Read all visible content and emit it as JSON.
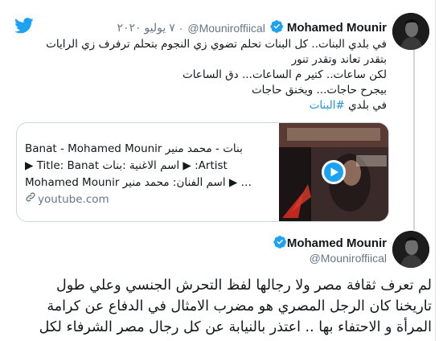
{
  "tweet1": {
    "author_name": "Mohamed Mounir",
    "handle": "@Mouniroffiical",
    "separator": "·",
    "date": "٧ يوليو ٢٠٢٠",
    "lines": [
      "في بلدي البنات.. كل البنات تحلم تضوي زي النجوم بتحلم ترفرف زي الرايات",
      "بتقدر تعاند وتقدر تنور",
      "لكن ساعات.. كتير م الساعات... دق الساعات",
      "بيجرح حاجات... ويخنق حاجات"
    ],
    "last_line_prefix": "في بلدي ",
    "hashtag": "#البنات"
  },
  "link_card": {
    "title": "Banat - Mohamed Mounir بنات - محمد منير",
    "desc_line1": "Artist: ▶ اسم الاغنية :بنات Title: Banat ▶",
    "desc_line2": "… ▶ اسم الفنان: محمد منير Mohamed Mounir",
    "domain": "youtube.com",
    "colors": {
      "border": "#ccd6dd",
      "play_button": "#1da1f2"
    }
  },
  "tweet2": {
    "author_name": "Mohamed Mounir",
    "handle": "@Mouniroffiical",
    "lines": [
      "لم تعرف ثقافة مصر ولا رجالها لفظ التحرش الجنسي وعلي طول",
      "تاريخنا كان الرجل المصري هو مضرب الامثال في الدفاع عن كرامة",
      "المرأة و الاحتفاء بها .. اعتذر بالنيابة عن كل رجال مصر الشرفاء لكل"
    ]
  },
  "colors": {
    "twitter_blue": "#1da1f2",
    "text": "#14171a",
    "muted": "#657786",
    "hashtag": "#1b95e0"
  },
  "icons": {
    "twitter_logo": "twitter-bird-icon",
    "verified": "verified-badge-icon",
    "link": "link-icon",
    "play": "play-icon"
  }
}
